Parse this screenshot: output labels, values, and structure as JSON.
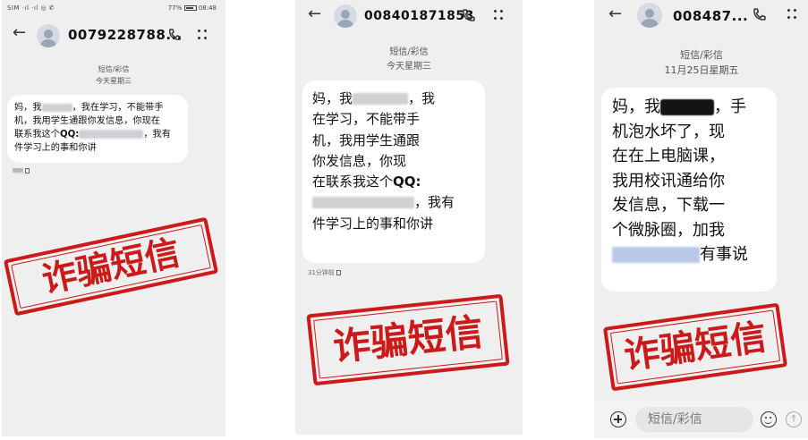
{
  "panels": [
    {
      "status": {
        "left": "SIM ·ıl ·ıl ◎ ✆",
        "battery": "77%",
        "time": "08:48"
      },
      "number": "0079228788...",
      "channel": "短信/彩信",
      "date": "今天星期三",
      "message_lines": [
        "妈，我",
        "，我在学习，不能带手",
        "机，我用学生通跟你发信息，你现在",
        "联系我这个",
        "QQ:",
        "，我有",
        "件学习上的事和你讲"
      ],
      "time_label": "刚刚",
      "stamp": "诈骗短信"
    },
    {
      "number": "008401871853",
      "channel": "短信/彩信",
      "date": "今天星期三",
      "message_lines": [
        "妈，我",
        "，我",
        "在学习，不能带手",
        "机，我用学生通跟",
        "你发信息，你现",
        "在联系我这个",
        "QQ:",
        "，我有",
        "件学习上的事和你讲"
      ],
      "time_label": "31分钟前",
      "stamp": "诈骗短信"
    },
    {
      "number": "008487...",
      "channel": "短信/彩信",
      "date": "11月25日星期五",
      "message_lines": [
        "妈，我",
        "，手",
        "机泡水坏了，现",
        "在在上电脑课，",
        "我用校讯通给你",
        "发信息，下载一",
        "个微脉圈，加我",
        "有事说"
      ],
      "stamp": "诈骗短信",
      "compose_placeholder": "短信/彩信"
    }
  ],
  "colors": {
    "stamp_red": "#cc1a1a",
    "panel_bg": "#efefef",
    "bubble_bg": "#ffffff"
  },
  "icons": [
    "back-arrow-icon",
    "avatar-icon",
    "phone-icon",
    "more-vertical-icon",
    "plus-icon",
    "emoji-icon",
    "send-icon",
    "document-icon"
  ]
}
